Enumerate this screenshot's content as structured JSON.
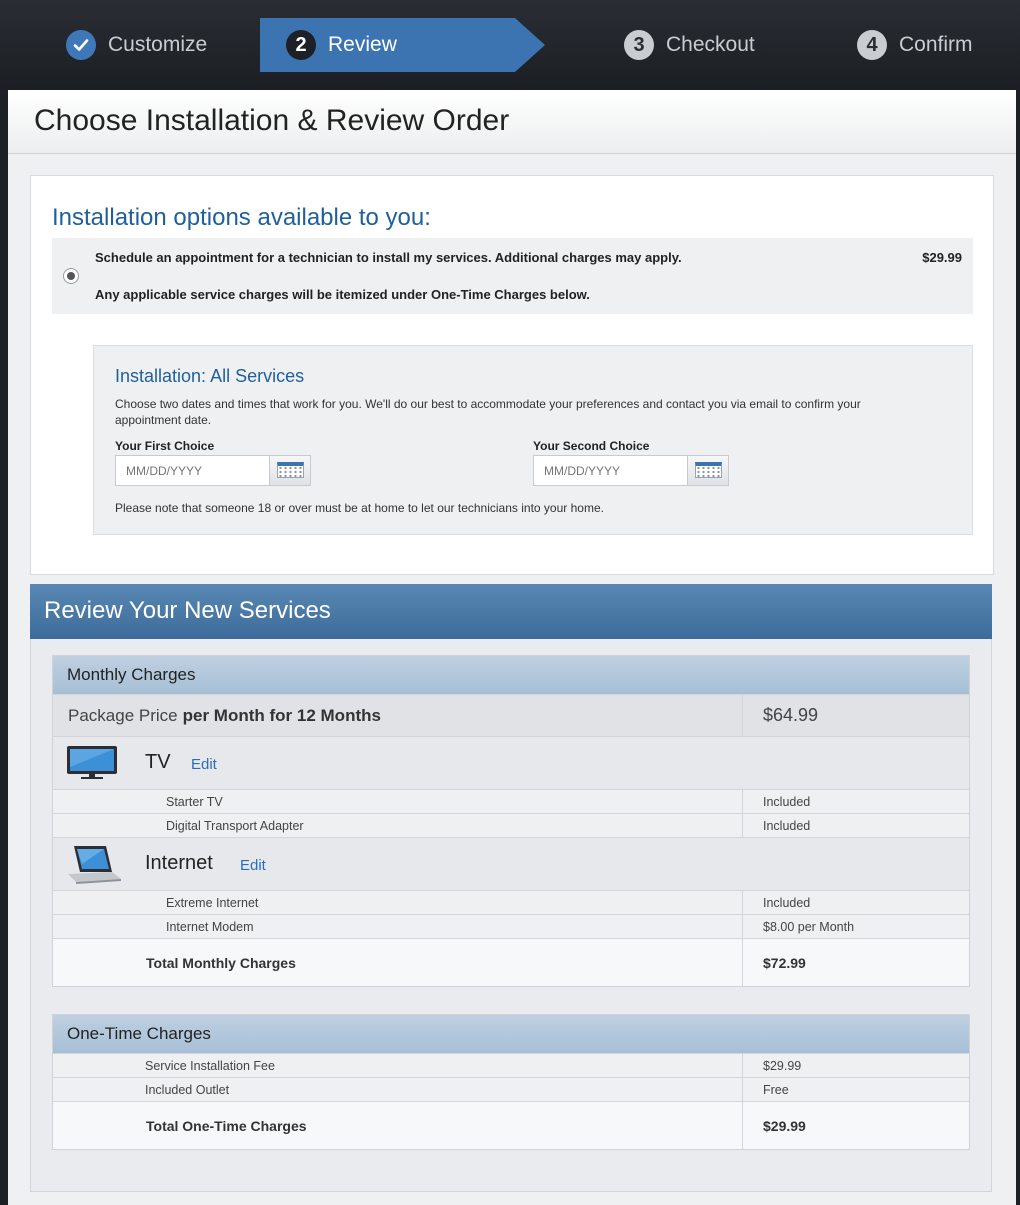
{
  "steps": [
    {
      "num": "✓",
      "label": "Customize",
      "state": "done"
    },
    {
      "num": "2",
      "label": "Review",
      "state": "active"
    },
    {
      "num": "3",
      "label": "Checkout",
      "state": "pending"
    },
    {
      "num": "4",
      "label": "Confirm",
      "state": "pending"
    }
  ],
  "page": {
    "title": "Choose Installation & Review Order"
  },
  "installation": {
    "heading": "Installation options available to you:",
    "option_text": "Schedule an appointment for a technician to install my services. Additional charges may apply.",
    "option_note": "Any applicable service charges will be itemized under One-Time Charges below.",
    "option_price": "$29.99",
    "schedule": {
      "title": "Installation: All Services",
      "description": "Choose two dates and times that work for you. We'll do our best to accommodate your preferences and contact you via email to confirm your appointment date.",
      "first_label": "Your First Choice",
      "second_label": "Your Second Choice",
      "date_placeholder": "MM/DD/YYYY",
      "note": "Please note that someone 18 or over must be at home to let our technicians into your home."
    }
  },
  "review": {
    "title": "Review Your New Services",
    "monthly": {
      "heading": "Monthly Charges",
      "package_label": "Package Price",
      "package_term": "per Month for 12 Months",
      "package_price": "$64.99",
      "tv": {
        "name": "TV",
        "edit": "Edit",
        "items": [
          {
            "name": "Starter TV",
            "price": "Included"
          },
          {
            "name": "Digital Transport Adapter",
            "price": "Included"
          }
        ]
      },
      "internet": {
        "name": "Internet",
        "edit": "Edit",
        "items": [
          {
            "name": "Extreme Internet",
            "price": "Included"
          },
          {
            "name": "Internet Modem",
            "price": "$8.00 per Month"
          }
        ]
      },
      "total_label": "Total Monthly Charges",
      "total_value": "$72.99"
    },
    "one_time": {
      "heading": "One-Time Charges",
      "items": [
        {
          "name": "Service Installation Fee",
          "price": "$29.99"
        },
        {
          "name": "Included Outlet",
          "price": "Free"
        }
      ],
      "total_label": "Total One-Time Charges",
      "total_value": "$29.99"
    }
  },
  "icons": {
    "check": "checkmark-icon",
    "calendar": "calendar-icon",
    "tv": "tv-icon",
    "laptop": "laptop-icon"
  },
  "colors": {
    "accent": "#3c74b2",
    "heading_blue": "#1f5f9c",
    "link": "#2a6fb6"
  }
}
